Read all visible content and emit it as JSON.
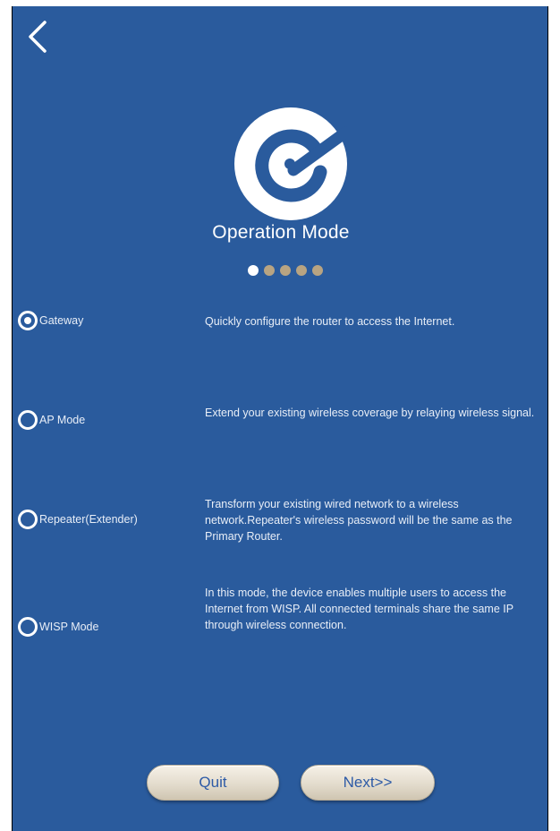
{
  "header": {
    "title": "Operation Mode",
    "back_icon": "chevron-left-icon",
    "logo_icon": "router-logo-icon"
  },
  "steps": {
    "current": 1,
    "total": 5
  },
  "modes": [
    {
      "label": "Gateway",
      "description": "Quickly configure the router to access the Internet.",
      "selected": true
    },
    {
      "label": "AP Mode",
      "description": "Extend your existing wireless coverage by relaying wireless signal.",
      "selected": false
    },
    {
      "label": "Repeater(Extender)",
      "description": "Transform your existing wired network to a wireless network.Repeater's wireless password will be the same as the Primary Router.",
      "selected": false
    },
    {
      "label": "WISP Mode",
      "description": "In this mode, the device enables multiple users to access the Internet from WISP. All connected terminals share the same IP through wireless connection.",
      "selected": false
    }
  ],
  "footer": {
    "quit_label": "Quit",
    "next_label": "Next>>"
  },
  "colors": {
    "background": "#2a5b9d",
    "dot_active": "#ffffff",
    "dot_inactive": "#b8a482",
    "button_text": "#2d5aa6"
  }
}
